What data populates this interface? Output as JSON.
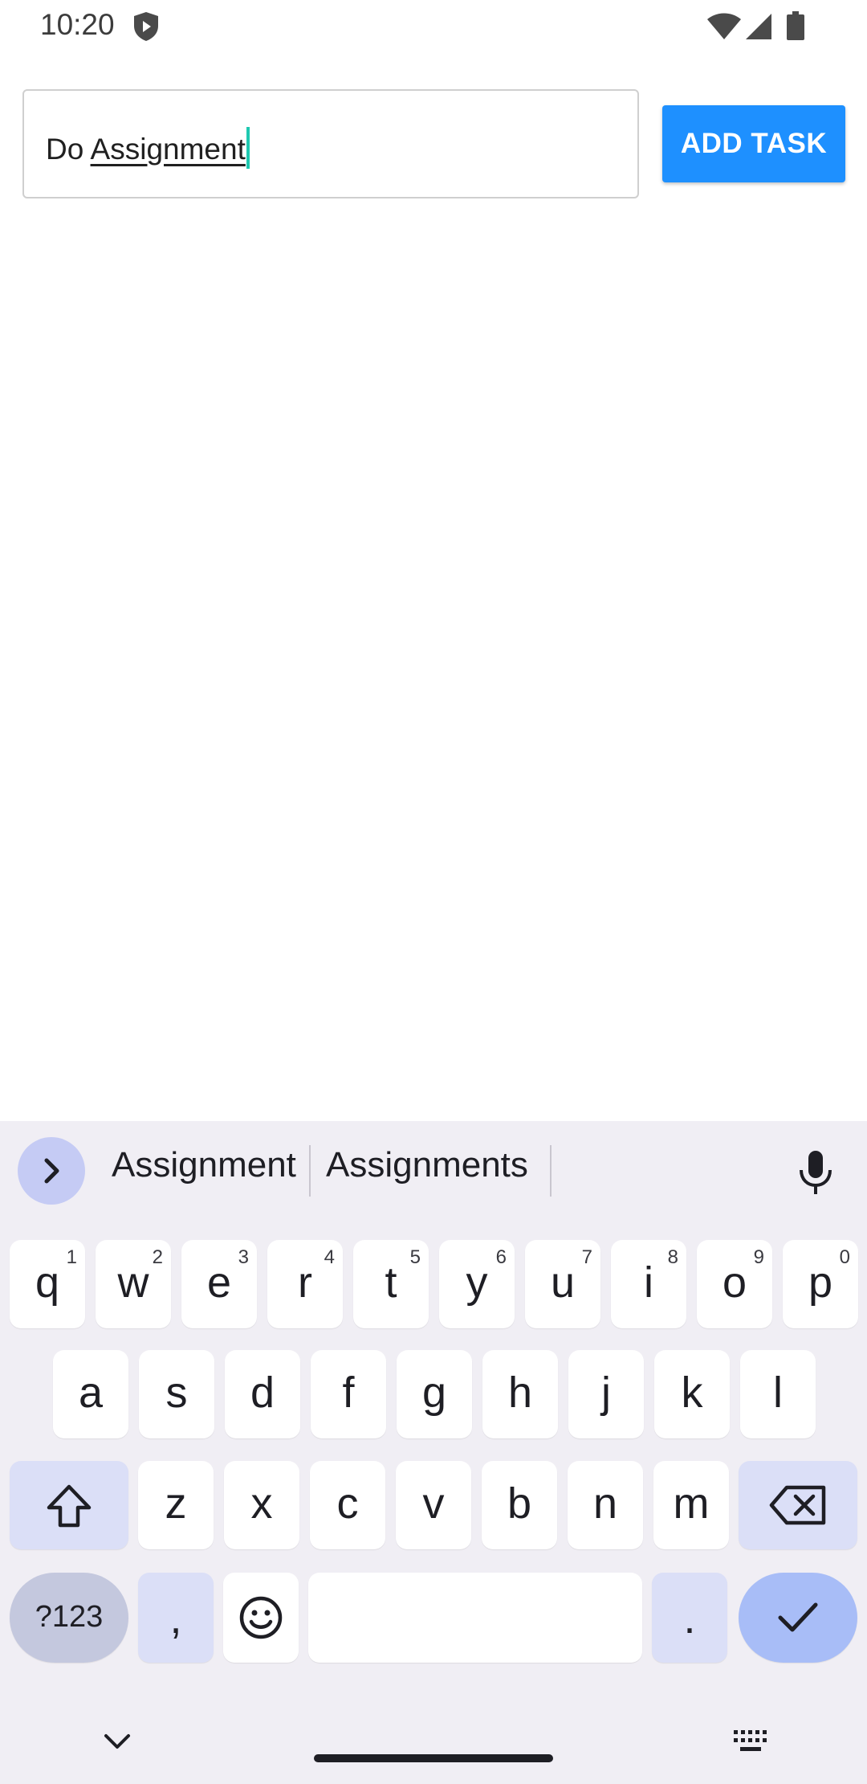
{
  "status_bar": {
    "time": "10:20"
  },
  "task_input": {
    "prefix": "Do ",
    "composing": "Assignment"
  },
  "add_task_button": {
    "label": "ADD TASK"
  },
  "keyboard": {
    "suggestions": [
      "Assignment",
      "Assignments"
    ],
    "row1": [
      {
        "ch": "q",
        "num": "1"
      },
      {
        "ch": "w",
        "num": "2"
      },
      {
        "ch": "e",
        "num": "3"
      },
      {
        "ch": "r",
        "num": "4"
      },
      {
        "ch": "t",
        "num": "5"
      },
      {
        "ch": "y",
        "num": "6"
      },
      {
        "ch": "u",
        "num": "7"
      },
      {
        "ch": "i",
        "num": "8"
      },
      {
        "ch": "o",
        "num": "9"
      },
      {
        "ch": "p",
        "num": "0"
      }
    ],
    "row2": [
      "a",
      "s",
      "d",
      "f",
      "g",
      "h",
      "j",
      "k",
      "l"
    ],
    "row3": [
      "z",
      "x",
      "c",
      "v",
      "b",
      "n",
      "m"
    ],
    "symbols_label": "?123",
    "comma_label": ",",
    "period_label": ".",
    "icons": {
      "expand": "chevron-right-icon",
      "mic": "microphone-icon",
      "shift": "shift-icon",
      "backspace": "backspace-icon",
      "emoji": "emoji-icon",
      "enter": "checkmark-icon",
      "hide": "chevron-down-icon",
      "switch": "keyboard-icon"
    }
  },
  "colors": {
    "accent": "#1e90ff",
    "caret": "#1ec8b0",
    "keyboard_bg": "#f0eef4",
    "key_dark": "#dbdff7",
    "enter_key": "#a8bdf7"
  }
}
